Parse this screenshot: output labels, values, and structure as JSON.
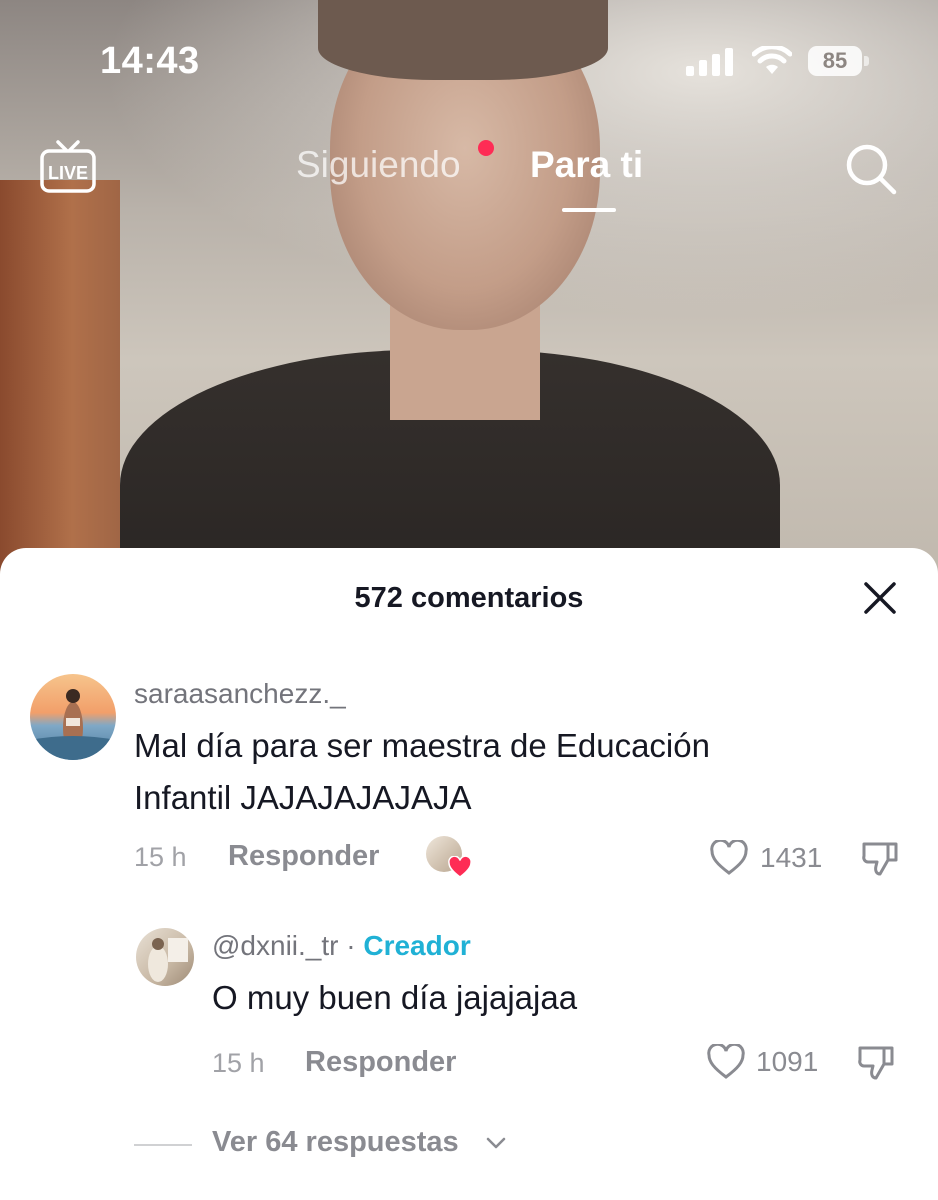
{
  "status_bar": {
    "time": "14:43",
    "battery": "85"
  },
  "top_nav": {
    "live_label": "LIVE",
    "tab_following": "Siguiendo",
    "tab_for_you": "Para ti"
  },
  "comments_sheet": {
    "title": "572 comentarios",
    "comments": [
      {
        "username": "saraasanchezz._",
        "text_line1": "Mal día para ser maestra de Educación",
        "text_line2": "Infantil JAJAJAJAJAJA",
        "time": "15 h",
        "reply_label": "Responder",
        "likes": "1431"
      }
    ],
    "reply": {
      "username": "@dxnii._tr",
      "separator": "·",
      "badge": "Creador",
      "text": "O muy buen día jajajajaa",
      "time": "15 h",
      "reply_label": "Responder",
      "likes": "1091"
    },
    "view_replies": "Ver 64 respuestas"
  },
  "colors": {
    "accent_red": "#fe2c55",
    "creator_blue": "#20b1d5"
  }
}
